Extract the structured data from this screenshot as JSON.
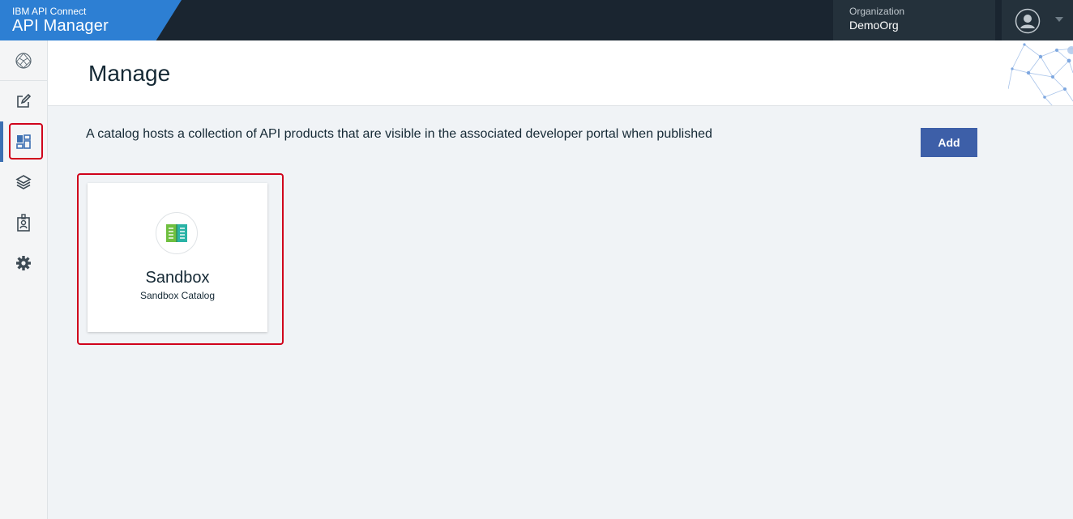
{
  "app": {
    "product_small": "IBM API Connect",
    "product_large": "API Manager"
  },
  "header": {
    "org_label": "Organization",
    "org_name": "DemoOrg"
  },
  "sidebar": {
    "items": [
      {
        "name": "home",
        "icon": "globe-icon"
      },
      {
        "name": "develop",
        "icon": "edit-icon"
      },
      {
        "name": "manage",
        "icon": "dashboard-icon",
        "active": true
      },
      {
        "name": "resources",
        "icon": "layers-icon"
      },
      {
        "name": "members",
        "icon": "badge-icon"
      },
      {
        "name": "settings",
        "icon": "gear-icon"
      }
    ]
  },
  "page": {
    "title": "Manage",
    "description": "A catalog hosts a collection of API products that are visible in the associated developer portal when published",
    "add_label": "Add"
  },
  "catalogs": [
    {
      "title": "Sandbox",
      "subtitle": "Sandbox Catalog",
      "icon": "catalog-book-icon"
    }
  ],
  "colors": {
    "brand_blue": "#2d7fd3",
    "topbar": "#1a2530",
    "primary_button": "#3d5fa8",
    "highlight_red": "#d0021b",
    "active_nav": "#3d70b2"
  }
}
